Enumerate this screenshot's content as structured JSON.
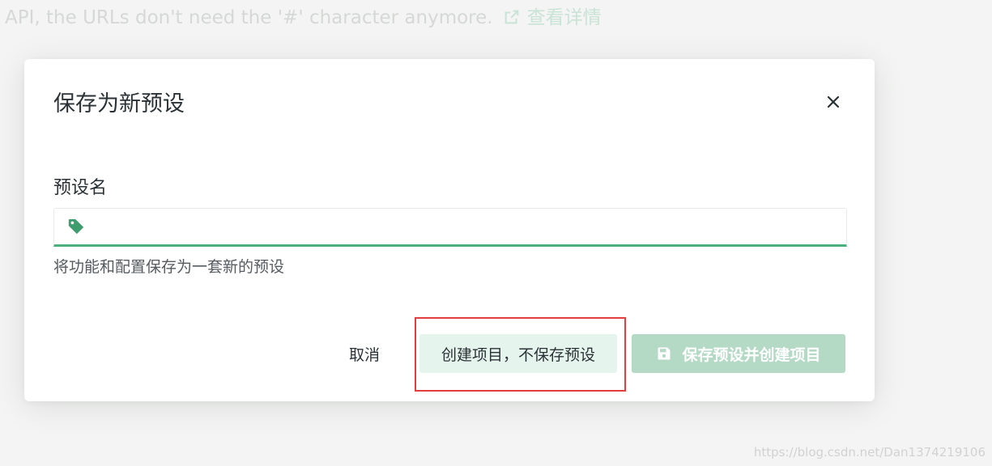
{
  "background_notice": {
    "text": "API, the URLs don't need the '#' character anymore.",
    "link_label": "查看详情"
  },
  "dialog": {
    "title": "保存为新预设",
    "field_label": "预设名",
    "input_value": "",
    "help_text": "将功能和配置保存为一套新的预设",
    "buttons": {
      "cancel": "取消",
      "create_without_preset": "创建项目，不保存预设",
      "save_and_create": "保存预设并创建项目"
    }
  },
  "watermark": "https://blog.csdn.net/Dan1374219106",
  "colors": {
    "accent": "#4caf7e",
    "accent_light": "#e6f4ee",
    "disabled_primary": "#b4dac6",
    "highlight": "#e33d3d",
    "text": "#2b3236"
  },
  "icons": {
    "link": "external-link-icon",
    "close": "close-icon",
    "tag": "tag-icon",
    "save": "floppy-disk-icon"
  }
}
